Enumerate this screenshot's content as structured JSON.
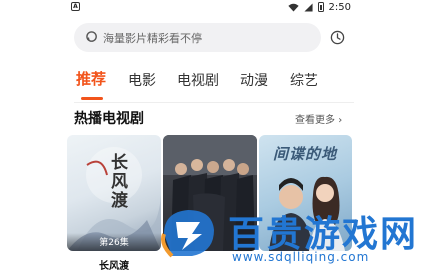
{
  "status_bar": {
    "left_icon": "A",
    "time": "2:50",
    "icons": [
      "wifi-icon",
      "signal-icon",
      "battery-icon"
    ]
  },
  "search": {
    "placeholder": "海量影片精彩看不停",
    "icon": "search-icon"
  },
  "history_icon": "clock-icon",
  "tabs": [
    {
      "label": "推荐",
      "active": true
    },
    {
      "label": "电影",
      "active": false
    },
    {
      "label": "电视剧",
      "active": false
    },
    {
      "label": "动漫",
      "active": false
    },
    {
      "label": "综艺",
      "active": false
    }
  ],
  "section": {
    "title": "热播电视剧",
    "more_label": "查看更多"
  },
  "posters": [
    {
      "label": "长风渡",
      "badge": "第26集",
      "art_text": "长风渡"
    },
    {
      "label": "",
      "badge": "",
      "art_text": ""
    },
    {
      "label": "",
      "badge": "",
      "art_text": "间谍的地"
    }
  ],
  "watermark": {
    "text": "百贵游戏网",
    "url": "www.sdqlliqing.com"
  },
  "colors": {
    "accent": "#f2541b",
    "watermark": "#2276d2",
    "search_bg": "#f1f1f3"
  }
}
